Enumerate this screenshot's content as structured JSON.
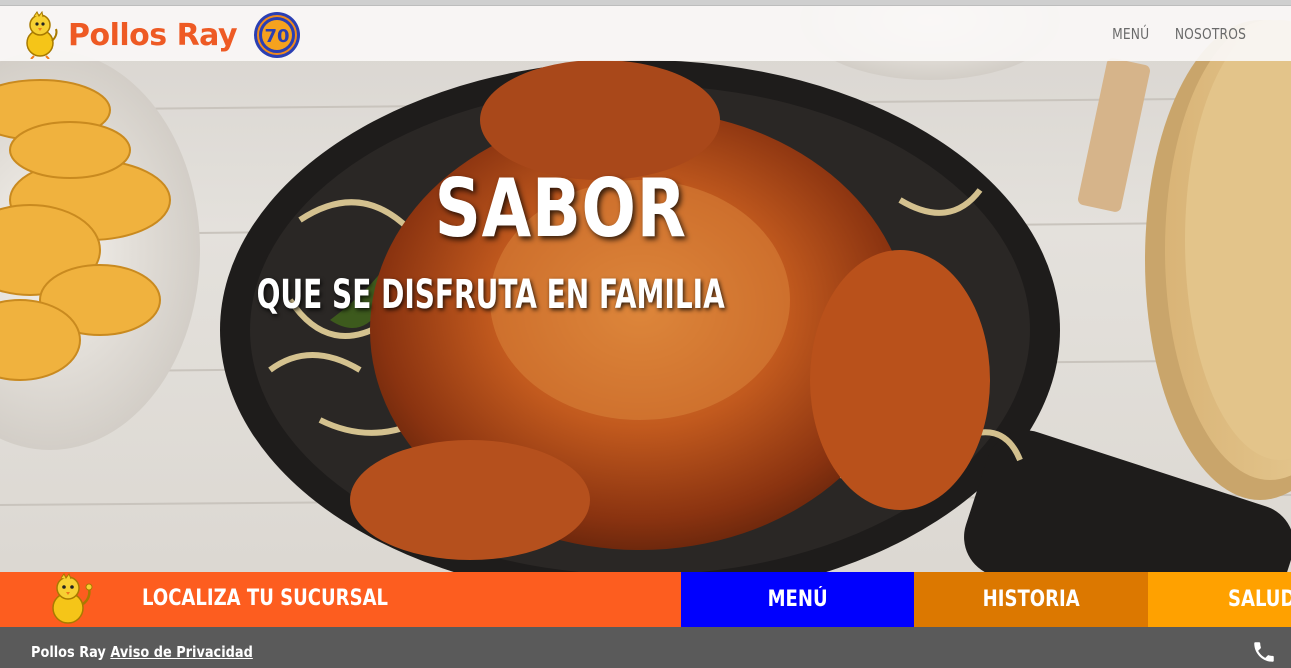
{
  "brand": {
    "name": "Pollos Ray",
    "logo_icon": "chick-mascot-icon",
    "seal_icon": "anniversary-seal-icon",
    "seal_number": "70"
  },
  "nav": {
    "items": [
      {
        "label": "MENÚ"
      },
      {
        "label": "NOSOTROS"
      }
    ]
  },
  "hero": {
    "title": "SABOR",
    "subtitle": "QUE SE DISFRUTA EN FAMILIA",
    "image": "roast-chicken-on-skillet-photo"
  },
  "action_bar": {
    "items": [
      {
        "label": "LOCALIZA TU SUCURSAL",
        "color": "#fd5d1f"
      },
      {
        "label": "MENÚ",
        "color": "#0000fe"
      },
      {
        "label": "HISTORIA",
        "color": "#dc7800"
      },
      {
        "label": "SALUD",
        "color": "#ffa100"
      }
    ]
  },
  "footer": {
    "brand": "Pollos Ray",
    "privacy_link": "Aviso de Privacidad",
    "phone_icon": "phone-icon"
  }
}
